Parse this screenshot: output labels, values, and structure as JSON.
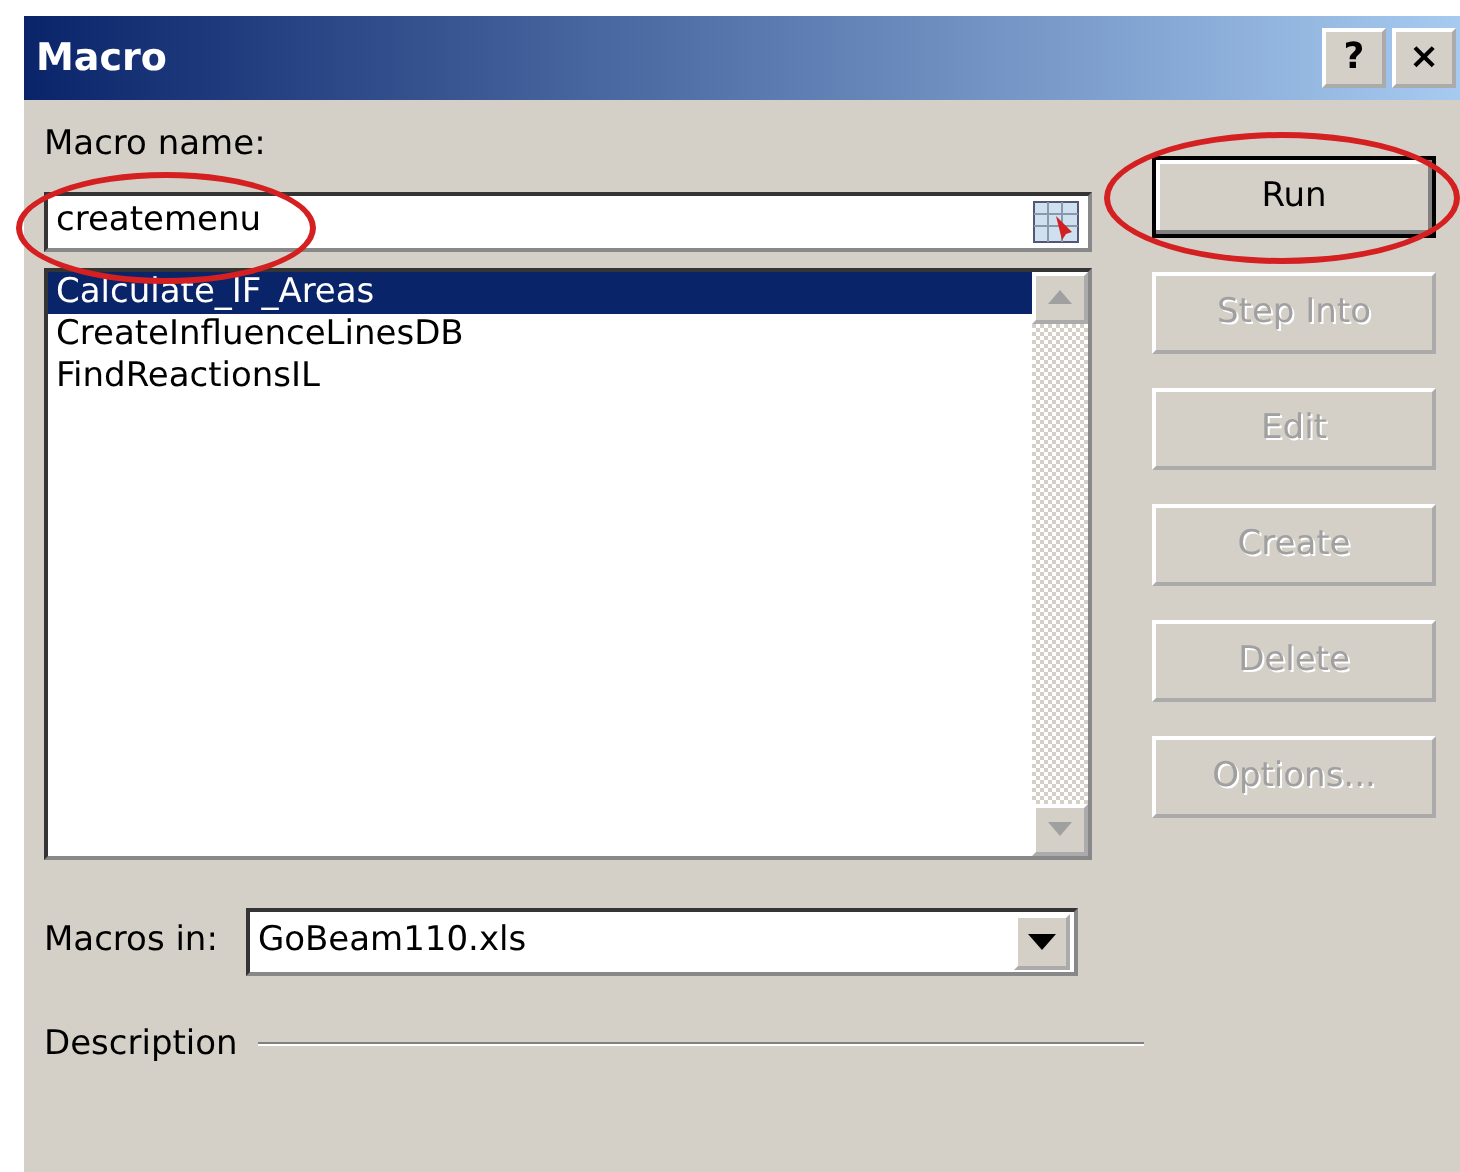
{
  "window": {
    "title": "Macro",
    "title_buttons": [
      "?",
      "×"
    ]
  },
  "macro_name": {
    "label": "Macro name:",
    "value": "createmenu",
    "highlighted": true
  },
  "macros": [
    {
      "name": "Calculate_IF_Areas",
      "selected": true
    },
    {
      "name": "CreateInfluenceLinesDB",
      "selected": false
    },
    {
      "name": "FindReactionsIL",
      "selected": false
    }
  ],
  "buttons": [
    {
      "label": "Run",
      "disabled": false,
      "highlighted": true
    },
    {
      "label": "Step Into",
      "disabled": true,
      "highlighted": false
    },
    {
      "label": "Edit",
      "disabled": true,
      "highlighted": false
    },
    {
      "label": "Create",
      "disabled": true,
      "highlighted": false
    },
    {
      "label": "Delete",
      "disabled": true,
      "highlighted": false
    },
    {
      "label": "Options...",
      "disabled": true,
      "highlighted": false
    }
  ],
  "macros_in": {
    "label": "Macros in:",
    "value": "GoBeam110.xls"
  },
  "description": {
    "label": "Description"
  }
}
